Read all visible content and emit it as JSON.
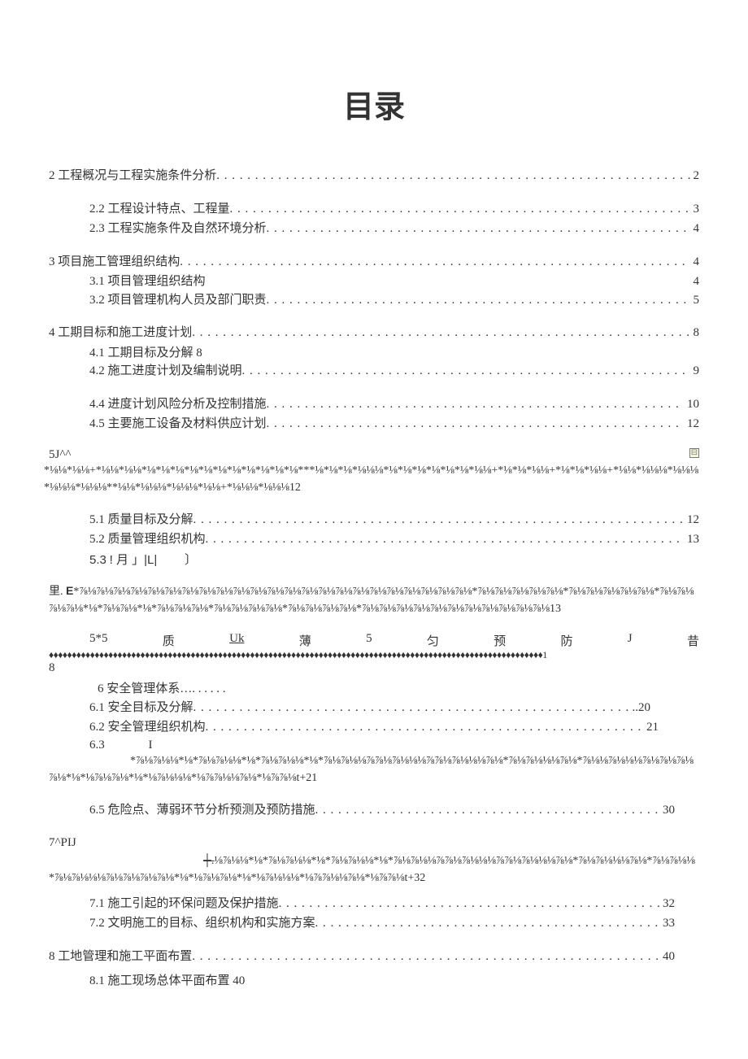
{
  "title": "目录",
  "lines": {
    "l2": {
      "label": "2 工程概况与工程实施条件分析",
      "page": "2"
    },
    "l22": {
      "label": "2.2 工程设计特点、工程量",
      "page": "3"
    },
    "l23": {
      "label": "2.3 工程实施条件及自然环境分析",
      "page": "4"
    },
    "l3": {
      "label": "3 项目施工管理组织结构",
      "page": "4"
    },
    "l31": {
      "label": "3.1 项目管理组织结构",
      "page": "4"
    },
    "l32": {
      "label": "3.2 项目管理机构人员及部门职责",
      "page": "5"
    },
    "l4": {
      "label": "4 工期目标和施工进度计划",
      "page": "8"
    },
    "l41": {
      "text": "4.1 工期目标及分解 8"
    },
    "l42": {
      "label": "4.2 施工进度计划及编制说明",
      "page": "9"
    },
    "l44": {
      "label": "4.4 进度计划风险分析及控制措施",
      "page": "10"
    },
    "l45": {
      "label": "4.5 主要施工设备及材料供应计划",
      "page": "12"
    },
    "l5j": {
      "left": "5J^^",
      "box": "⊟"
    },
    "l5garble": "*⅛⅛*⅛⅛+*⅛⅛*⅛⅛*⅛*⅛*⅛*⅛*⅛*⅛*⅛*⅛*⅛*⅛*⅛***⅛*⅛*⅛*⅛⅛⅛*⅛*⅛*⅛*⅛*⅛*⅛*⅛⅛+*⅛*⅛*⅛⅛+*⅛*⅛*⅛⅛+*⅛⅛*⅛⅛⅛*⅛⅛⅛*⅛⅛⅛*⅛⅛⅛**⅛⅛*⅛⅛⅛*⅛⅛⅛*⅛⅛+*⅛⅛⅛*⅛⅛⅛12",
    "l51": {
      "label": "5.1 质量目标及分解",
      "page": "12"
    },
    "l52": {
      "label": "5.2 质量管理组织机构",
      "page": "13"
    },
    "l53": {
      "a": "5.3",
      "b": "! 月 」|L|",
      "c": "〕"
    },
    "liE": {
      "lead": "里. ",
      "e": "E",
      "rest": "*⅞⅛⅞⅛⅞⅛⅞⅛⅞⅛⅞⅛⅞⅛⅞⅛⅞⅛⅞⅛⅞⅛⅞⅛⅞⅛⅞⅛⅞⅛⅞⅛⅞⅛⅞⅛⅞⅛⅞⅛⅞⅛⅞⅛⅞⅛*⅞⅛⅞⅛⅞⅛⅞⅛⅞⅛*⅞⅛⅞⅛⅞⅛⅞⅛⅞⅛*⅞⅛⅞⅛⅞⅛⅞⅛*⅛*⅞⅛⅞⅛*⅛*⅞⅛⅞⅛⅞⅛*⅞⅛⅞⅛⅞⅛⅞⅛*⅞⅛⅞⅛⅞⅛⅞⅛*⅞⅛⅞⅛⅞⅛⅞⅛⅞⅛⅞⅛⅞⅛⅞⅛⅞⅛⅞⅛⅞⅛13"
    },
    "row55": {
      "c1": "5*5",
      "c2": "质",
      "c3": "Uk",
      "c4": "薄",
      "c5": "5",
      "c6": "匀",
      "c7": "预",
      "c8": "防",
      "c9": "J",
      "c10": "昔"
    },
    "diamonds": "♦♦♦♦♦♦♦♦♦♦♦♦♦♦♦♦♦♦♦♦♦♦♦♦♦♦♦♦♦♦♦♦♦♦♦♦♦♦♦♦♦♦♦♦♦♦♦♦♦♦♦♦♦♦♦♦♦♦♦♦♦♦♦♦♦♦♦♦♦♦♦♦♦♦♦♦♦♦♦♦♦♦♦♦♦♦♦♦♦♦♦♦♦♦♦♦♦♦♦♦♦♦♦♦♦♦♦♦1",
    "dangle8": "8",
    "l6": {
      "text": "6   安全管理体系…. . . . . ."
    },
    "l61": {
      "label": "6.1 安全目标及分解",
      "page": "..20"
    },
    "l62": {
      "label": "6.2 安全管理组织机构",
      "page": "21"
    },
    "l63": {
      "a": "6.3",
      "b": "I"
    },
    "l63garble": "*⅞⅛⅞⅛⅛*⅛*⅞⅛⅞⅛⅛*⅛*⅞⅛⅞⅛⅛*⅛*⅞⅛⅞⅛⅛⅞⅞⅛⅞⅛⅛⅛⅞⅞⅛⅞⅛⅛⅛⅞⅛*⅞⅛⅞⅛⅛⅛⅞⅛*⅞⅛⅛⅞⅛⅛⅛⅞⅛⅞⅛⅞⅛⅞⅛*⅛*⅛⅞⅛⅞⅛*⅛*⅛⅞⅛⅛⅛*⅛⅞⅞⅛⅛⅞⅛*⅛⅞⅞⅛t+21",
    "l65": {
      "label": "6.5 危险点、薄弱环节分析预测及预防措施",
      "page": "30"
    },
    "l7": "7^PIJ",
    "l7garble_start": "┼.",
    "l7garble_rest": "⅛⅞⅛⅛*⅛*⅞⅛⅞⅛⅛*⅛*⅞⅛⅞⅛⅛*⅛*⅞⅛⅞⅛⅛⅞⅞⅛⅞⅛⅛⅛⅞⅞⅛⅞⅛⅛⅛⅞⅛*⅞⅛⅞⅛⅛⅛⅞⅛*⅞⅛⅞⅛⅛*⅞⅛⅞⅛⅛⅛⅞⅛⅞⅛⅞⅛⅞⅛*⅛*⅛⅞⅛⅞⅛*⅛*⅛⅞⅛⅛⅛*⅛⅞⅞⅛⅛⅞⅛*⅛⅞⅞⅛t+32",
    "l71": {
      "label": "7.1 施工引起的环保问题及保护措施",
      "page": "32"
    },
    "l72": {
      "label": "7.2 文明施工的目标、组织机构和实施方案",
      "page": "33"
    },
    "l8": {
      "label": "8 工地管理和施工平面布置",
      "page": "40"
    },
    "l81": {
      "text": "8.1 施工现场总体平面布置 40"
    }
  },
  "dots": ". . . . . . . . . . . . . . . . . . . . . . . . . . . . . . . . . . . . . . . . . . . . . . . . . . . . . . . . . . . . . . . . . . . . . . . . . . . . . . . . . . . . . . . . . . . . . . . ."
}
